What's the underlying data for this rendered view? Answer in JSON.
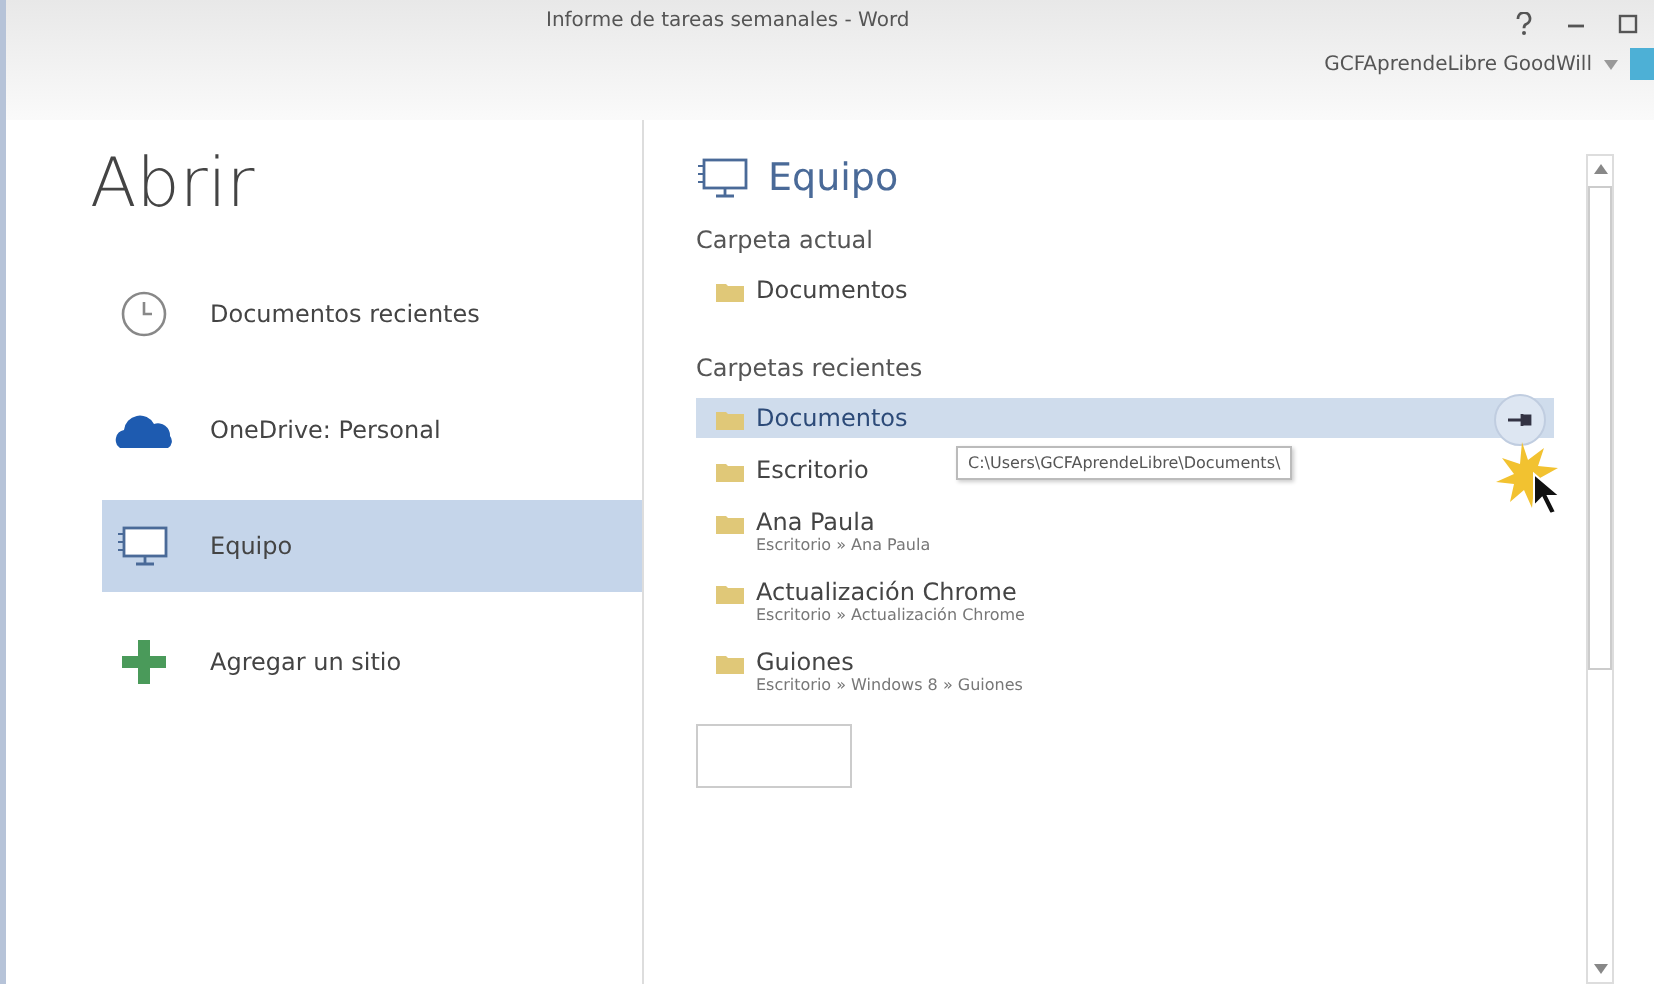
{
  "window": {
    "title": "Informe de tareas semanales - Word",
    "user": "GCFAprendeLibre GoodWill"
  },
  "heading": "Abrir",
  "places": [
    {
      "label": "Documentos recientes",
      "kind": "clock",
      "selected": false
    },
    {
      "label": "OneDrive: Personal",
      "kind": "cloud",
      "selected": false
    },
    {
      "label": "Equipo",
      "kind": "computer",
      "selected": true
    },
    {
      "label": "Agregar un sitio",
      "kind": "plus",
      "selected": false
    }
  ],
  "panel": {
    "title": "Equipo",
    "current_label": "Carpeta actual",
    "current": [
      {
        "name": "Documentos",
        "selected": false
      }
    ],
    "recent_label": "Carpetas recientes",
    "recent": [
      {
        "name": "Documentos",
        "selected": true,
        "tooltip": "C:\\Users\\GCFAprendeLibre\\Documents\\"
      },
      {
        "name": "Escritorio",
        "selected": false
      },
      {
        "name": "Ana Paula",
        "path": "Escritorio » Ana Paula",
        "selected": false
      },
      {
        "name": "Actualización Chrome",
        "path": "Escritorio » Actualización Chrome",
        "selected": false
      },
      {
        "name": "Guiones",
        "path": "Escritorio » Windows 8 » Guiones",
        "selected": false
      }
    ]
  }
}
